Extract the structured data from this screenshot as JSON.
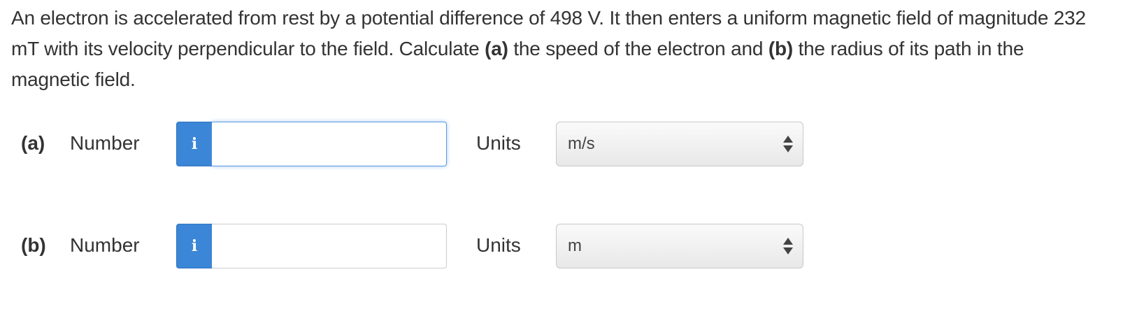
{
  "question": {
    "text_1": "An electron is accelerated from rest by a potential difference of 498 V. It then enters a uniform magnetic field of magnitude 232 mT with its velocity perpendicular to the field. Calculate ",
    "part_a": "(a)",
    "text_2": " the speed of the electron and ",
    "part_b": "(b)",
    "text_3": " the radius of its path in the magnetic field."
  },
  "answers": [
    {
      "part_label": "(a)",
      "number_label": "Number",
      "info_glyph": "i",
      "info_icon": "info-icon",
      "value": "",
      "units_label": "Units",
      "units_selected": "m/s",
      "focused": true
    },
    {
      "part_label": "(b)",
      "number_label": "Number",
      "info_glyph": "i",
      "info_icon": "info-icon",
      "value": "",
      "units_label": "Units",
      "units_selected": "m",
      "focused": false
    }
  ],
  "colors": {
    "info_button": "#3b86d6",
    "focus_border": "#5d9ae0",
    "text": "#333333"
  }
}
